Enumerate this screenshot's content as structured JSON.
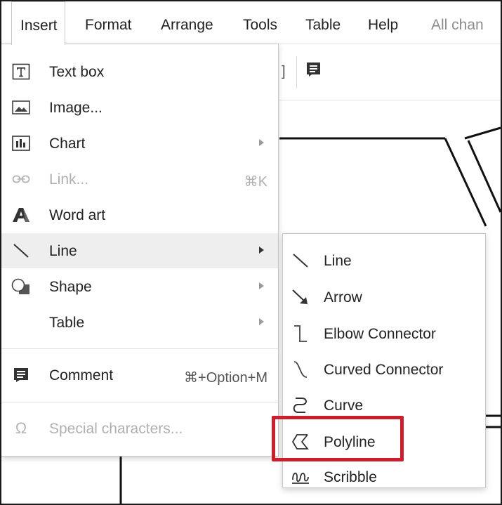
{
  "menubar": {
    "items": [
      {
        "label": "Insert"
      },
      {
        "label": "Format"
      },
      {
        "label": "Arrange"
      },
      {
        "label": "Tools"
      },
      {
        "label": "Table"
      },
      {
        "label": "Help"
      },
      {
        "label": "All chan"
      }
    ]
  },
  "insert_menu": {
    "items": [
      {
        "label": "Text box",
        "icon": "text-box-icon"
      },
      {
        "label": "Image...",
        "icon": "image-icon"
      },
      {
        "label": "Chart",
        "icon": "chart-icon",
        "submenu": true
      },
      {
        "label": "Link...",
        "icon": "link-icon",
        "shortcut": "⌘K",
        "disabled": true
      },
      {
        "label": "Word art",
        "icon": "word-art-icon"
      },
      {
        "label": "Line",
        "icon": "line-icon",
        "submenu": true,
        "highlighted": true
      },
      {
        "label": "Shape",
        "icon": "shape-icon",
        "submenu": true
      },
      {
        "label": "Table",
        "submenu": true
      },
      {
        "label": "Comment",
        "icon": "comment-icon",
        "shortcut": "⌘+Option+M"
      },
      {
        "label": "Special characters...",
        "icon": "omega-icon",
        "disabled": true
      }
    ]
  },
  "line_submenu": {
    "items": [
      {
        "label": "Line",
        "icon": "line-icon"
      },
      {
        "label": "Arrow",
        "icon": "arrow-icon"
      },
      {
        "label": "Elbow Connector",
        "icon": "elbow-connector-icon"
      },
      {
        "label": "Curved Connector",
        "icon": "curved-connector-icon"
      },
      {
        "label": "Curve",
        "icon": "curve-icon"
      },
      {
        "label": "Polyline",
        "icon": "polyline-icon",
        "highlighted_by_annotation": true
      },
      {
        "label": "Scribble",
        "icon": "scribble-icon"
      }
    ]
  },
  "toolbar": {
    "bracket_glyph": "]"
  },
  "colors": {
    "annotation_red": "#cc1f2e",
    "hover_gray": "#eeeeee",
    "disabled_text": "#b0b0b0"
  }
}
